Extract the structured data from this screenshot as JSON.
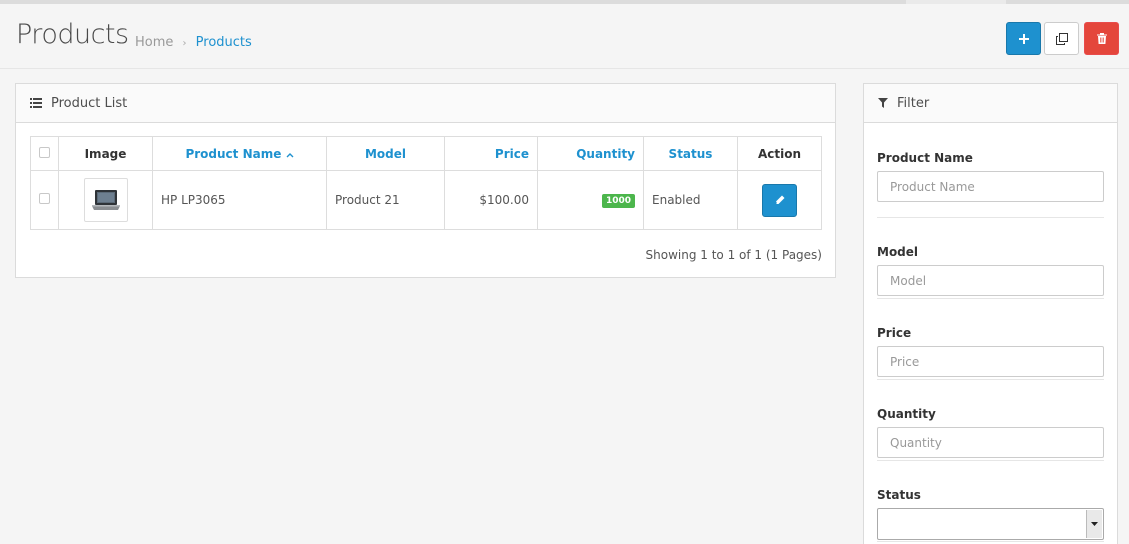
{
  "header": {
    "title": "Products",
    "breadcrumb": [
      {
        "label": "Home"
      },
      {
        "label": "Products"
      }
    ],
    "breadcrumb_sep": "›",
    "buttons": {
      "add_icon": "plus-icon",
      "copy_icon": "copy-icon",
      "delete_icon": "trash-icon"
    }
  },
  "product_list": {
    "heading": "Product List",
    "heading_icon": "list-icon",
    "columns": {
      "image": "Image",
      "name": "Product Name",
      "model": "Model",
      "price": "Price",
      "quantity": "Quantity",
      "status": "Status",
      "action": "Action"
    },
    "rows": [
      {
        "image_icon": "laptop-thumbnail",
        "name": "HP LP3065",
        "model": "Product 21",
        "price": "$100.00",
        "quantity": "1000",
        "status": "Enabled"
      }
    ],
    "pagination_text": "Showing 1 to 1 of 1 (1 Pages)"
  },
  "filter": {
    "heading": "Filter",
    "heading_icon": "filter-icon",
    "fields": {
      "product_name": {
        "label": "Product Name",
        "placeholder": "Product Name"
      },
      "model": {
        "label": "Model",
        "placeholder": "Model"
      },
      "price": {
        "label": "Price",
        "placeholder": "Price"
      },
      "quantity": {
        "label": "Quantity",
        "placeholder": "Quantity"
      },
      "status": {
        "label": "Status",
        "value": ""
      }
    }
  },
  "colors": {
    "primary": "#1e91cf",
    "danger": "#e4463b",
    "success": "#4cb64c"
  }
}
